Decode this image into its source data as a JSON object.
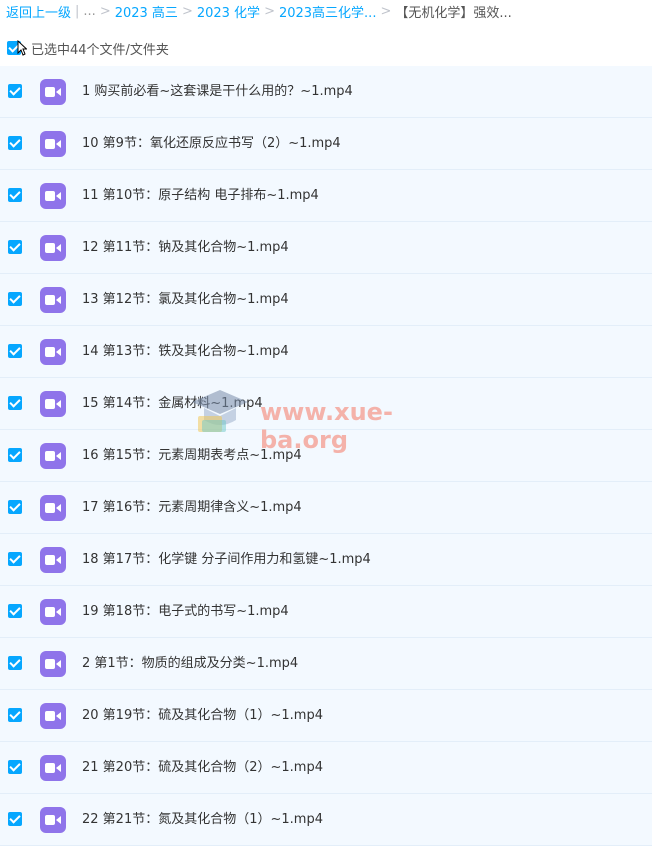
{
  "breadcrumb": {
    "back": "返回上一级",
    "sep_bar": "|",
    "dots": "...",
    "sep": ">",
    "items": [
      "2023 高三",
      "2023 化学",
      "2023高三化学..."
    ],
    "current": "【无机化学】强效..."
  },
  "selection": {
    "label": "已选中44个文件/文件夹"
  },
  "files": [
    {
      "name": "1 购买前必看~这套课是干什么用的？~1.mp4"
    },
    {
      "name": "10 第9节：氧化还原反应书写（2）~1.mp4"
    },
    {
      "name": "11 第10节：原子结构 电子排布~1.mp4"
    },
    {
      "name": "12 第11节：钠及其化合物~1.mp4"
    },
    {
      "name": "13 第12节：氯及其化合物~1.mp4"
    },
    {
      "name": "14 第13节：铁及其化合物~1.mp4"
    },
    {
      "name": "15 第14节：金属材料~1.mp4"
    },
    {
      "name": "16 第15节：元素周期表考点~1.mp4"
    },
    {
      "name": "17 第16节：元素周期律含义~1.mp4"
    },
    {
      "name": "18 第17节：化学键 分子间作用力和氢键~1.mp4"
    },
    {
      "name": "19 第18节：电子式的书写~1.mp4"
    },
    {
      "name": "2 第1节：物质的组成及分类~1.mp4"
    },
    {
      "name": "20 第19节：硫及其化合物（1）~1.mp4"
    },
    {
      "name": "21 第20节：硫及其化合物（2）~1.mp4"
    },
    {
      "name": "22 第21节：氮及其化合物（1）~1.mp4"
    }
  ],
  "watermark": {
    "text": "www.xue-ba.org"
  },
  "colors": {
    "accent": "#06a7ff",
    "row_bg": "#f3f9ff",
    "video_icon": "#8f74ea"
  }
}
